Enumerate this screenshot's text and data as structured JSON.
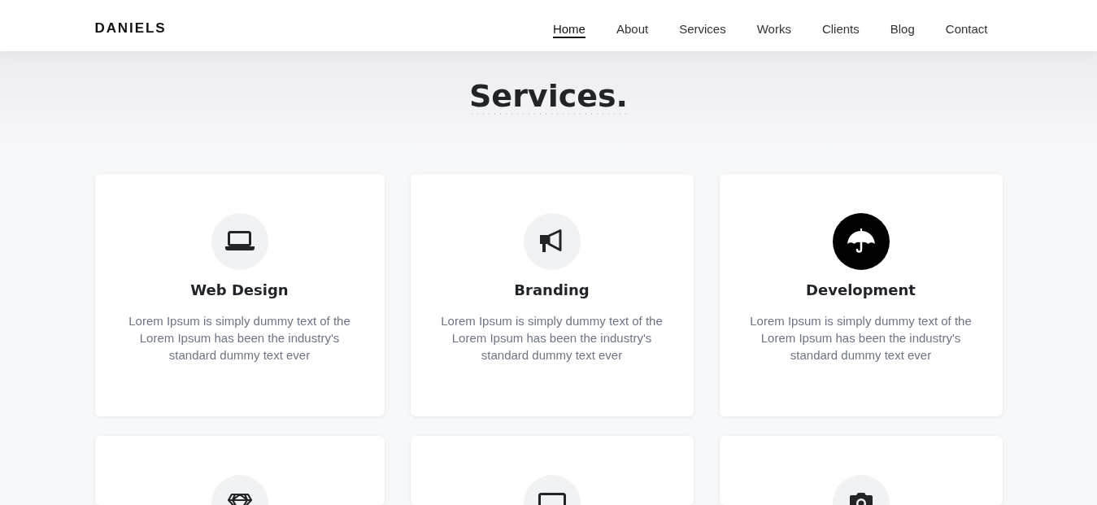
{
  "header": {
    "logo": "DANIELS",
    "nav": [
      {
        "label": "Home",
        "selected": true
      },
      {
        "label": "About",
        "selected": false
      },
      {
        "label": "Services",
        "selected": false
      },
      {
        "label": "Works",
        "selected": false
      },
      {
        "label": "Clients",
        "selected": false
      },
      {
        "label": "Blog",
        "selected": false
      },
      {
        "label": "Contact",
        "selected": false
      }
    ]
  },
  "services": {
    "title": "Services.",
    "items": [
      {
        "title": "Web Design",
        "description": "Lorem Ipsum is simply dummy text of the Lorem Ipsum has been the industry's standard dummy text ever",
        "highlighted": false
      },
      {
        "title": "Branding",
        "description": "Lorem Ipsum is simply dummy text of the Lorem Ipsum has been the industry's standard dummy text ever",
        "highlighted": false
      },
      {
        "title": "Development",
        "description": "Lorem Ipsum is simply dummy text of the Lorem Ipsum has been the industry's standard dummy text ever",
        "highlighted": true
      },
      {
        "highlighted": false
      },
      {
        "highlighted": false
      },
      {
        "highlighted": false
      }
    ]
  }
}
